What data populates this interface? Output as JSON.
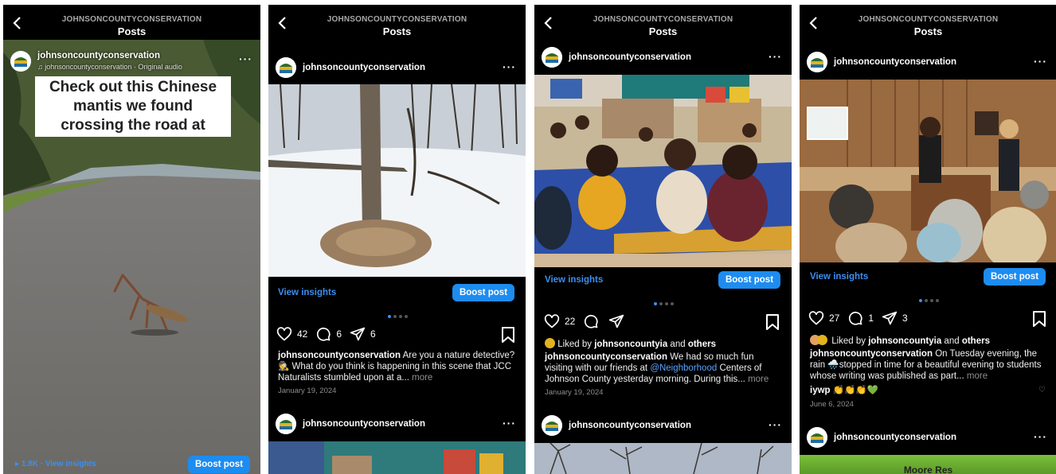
{
  "common": {
    "account_header": "JOHNSONCOUNTYCONSERVATION",
    "page_title": "Posts",
    "username": "johnsoncountyconservation",
    "view_insights": "View insights",
    "boost_post": "Boost post",
    "more": "more"
  },
  "reel": {
    "audio": "johnsoncountyconservation · Original audio",
    "overlay_text": "Check out this Chinese mantis we found crossing the road at",
    "views": "1.8K",
    "view_insights": "· View insights"
  },
  "post2": {
    "likes": "42",
    "comments": "6",
    "shares": "6",
    "caption": "Are you a nature detective? 🕵️ What do you think is happening in this scene that JCC Naturalists stumbled upon at a...",
    "date": "January 19, 2024"
  },
  "post3": {
    "likes": "22",
    "liked_by_prefix": "Liked by ",
    "liked_by_user": "johnsoncountyia",
    "liked_by_and": " and ",
    "liked_by_others": "others",
    "caption_a": "We had so much fun visiting with our friends at ",
    "caption_link": "@Neighborhood",
    "caption_b": " Centers of Johnson County yesterday morning. During this...",
    "date": "January 19, 2024"
  },
  "post4": {
    "likes": "27",
    "comments": "1",
    "shares": "3",
    "liked_by_prefix": "Liked by ",
    "liked_by_user": "johnsoncountyia",
    "liked_by_and": " and ",
    "liked_by_others": "others",
    "caption": "On Tuesday evening, the rain 🌧️stopped in time for a beautiful evening to students whose writing was published as part...",
    "comment_user": "iywp",
    "comment_text": "👏👏👏💚",
    "date": "June 6, 2024",
    "next_image_text": "Moore Res"
  },
  "colors": {
    "accent": "#1d8cf0",
    "link": "#3b8ff0",
    "background": "#000000"
  }
}
